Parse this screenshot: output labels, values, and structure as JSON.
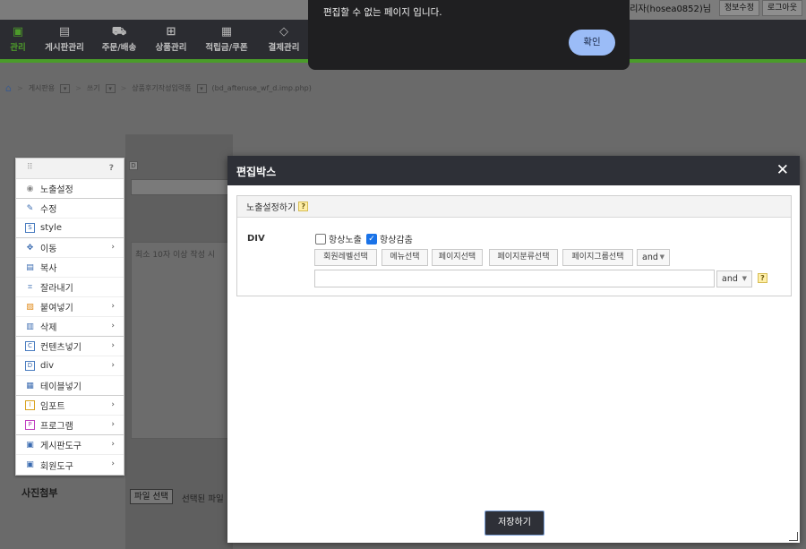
{
  "topbar": {
    "user": "관리자(hosea0852)님",
    "edit_info": "정보수정",
    "logout": "로그아웃"
  },
  "nav": [
    {
      "label": "관리",
      "icon": "gear-icon",
      "active": true
    },
    {
      "label": "게시판관리",
      "icon": "board-icon"
    },
    {
      "label": "주문/배송",
      "icon": "truck-icon"
    },
    {
      "label": "상품관리",
      "icon": "gift-icon"
    },
    {
      "label": "적립금/쿠폰",
      "icon": "coupon-icon"
    },
    {
      "label": "결제관리",
      "icon": "eraser-icon"
    }
  ],
  "breadcrumb": {
    "item1": "게시판용",
    "item2": "쓰기",
    "item3": "상품후기작성입력폼",
    "file": "(bd_afteruse_wf_d.imp.php)"
  },
  "alert": {
    "message": "편집할 수 없는 페이지 입니다.",
    "ok": "확인"
  },
  "context_menu": {
    "items": [
      {
        "label": "노출설정",
        "icon": "eye-icon",
        "submenu": false
      },
      {
        "label": "수정",
        "icon": "pencil-icon",
        "submenu": false
      },
      {
        "label": "style",
        "icon": "style-icon",
        "submenu": false
      },
      {
        "label": "이동",
        "icon": "move-icon",
        "submenu": true
      },
      {
        "label": "복사",
        "icon": "copy-icon",
        "submenu": false
      },
      {
        "label": "잘라내기",
        "icon": "crop-icon",
        "submenu": false
      },
      {
        "label": "붙여넣기",
        "icon": "paste-icon",
        "submenu": true
      },
      {
        "label": "삭제",
        "icon": "trash-icon",
        "submenu": true
      },
      {
        "label": "컨텐츠넣기",
        "icon": "content-icon",
        "submenu": true
      },
      {
        "label": "div",
        "icon": "div-icon",
        "submenu": true
      },
      {
        "label": "테이블넣기",
        "icon": "table-icon",
        "submenu": false
      },
      {
        "label": "임포트",
        "icon": "import-icon",
        "submenu": true
      },
      {
        "label": "프로그램",
        "icon": "program-icon",
        "submenu": true
      },
      {
        "label": "게시판도구",
        "icon": "board-tool-icon",
        "submenu": true
      },
      {
        "label": "회원도구",
        "icon": "member-tool-icon",
        "submenu": true
      }
    ]
  },
  "modal": {
    "title": "편집박스",
    "section_title": "노출설정하기",
    "row_label": "DIV",
    "always_show": "항상노출",
    "always_hide": "항상감춤",
    "filter_buttons": [
      "회원레벨선택",
      "메뉴선택",
      "페이지선택",
      "페이지분류선택",
      "페이지그룹선택"
    ],
    "and_select_1": "and",
    "and_select_2": "and",
    "save": "저장하기",
    "always_hide_checked": true,
    "always_show_checked": false
  },
  "page": {
    "photo_label": "사진첨부",
    "file_button": "파일 선택",
    "file_note": "선택된 파일",
    "textarea_hint": "최소 10자 이상 작성 시"
  }
}
